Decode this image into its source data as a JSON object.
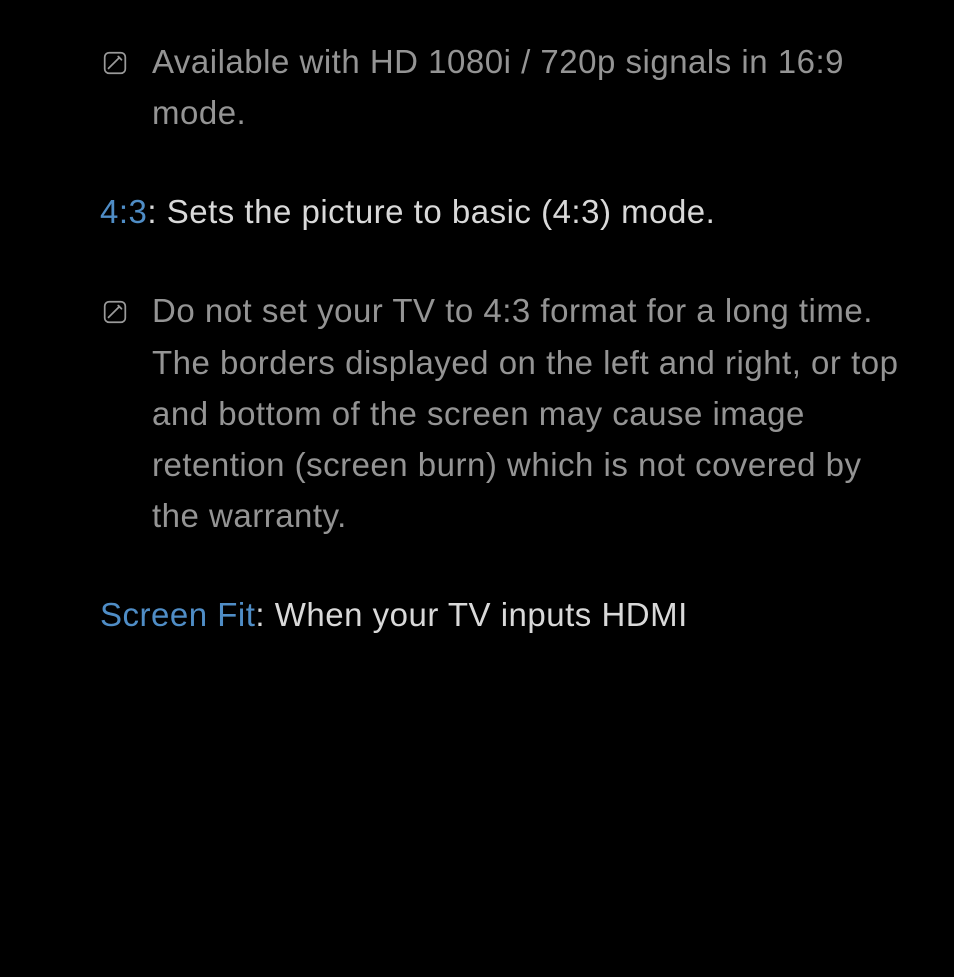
{
  "note1": {
    "text": "Available with HD 1080i / 720p signals in 16:9 mode."
  },
  "entry1": {
    "label": "4:3",
    "sep": ": ",
    "body": "Sets the picture to basic (4:3) mode."
  },
  "note2": {
    "text": "Do not set your TV to 4:3 format for a long time. The borders displayed on the left and right, or top and bottom of the screen may cause image retention (screen burn) which is not covered by the warranty."
  },
  "entry2": {
    "label": "Screen Fit",
    "sep": ": ",
    "body": "When your TV inputs HDMI"
  }
}
